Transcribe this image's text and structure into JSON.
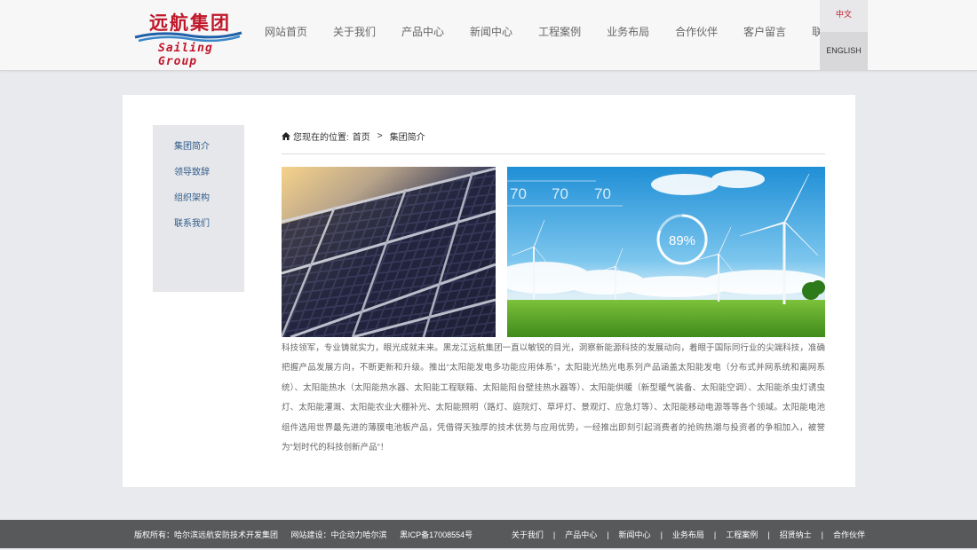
{
  "header": {
    "logo": {
      "cn": "远航集团",
      "en": "Sailing Group"
    },
    "nav": [
      "网站首页",
      "关于我们",
      "产品中心",
      "新闻中心",
      "工程案例",
      "业务布局",
      "合作伙伴",
      "客户留言",
      "联系我们"
    ],
    "lang": {
      "cn": "中文",
      "en": "ENGLISH"
    }
  },
  "sidebar": {
    "items": [
      "集团简介",
      "领导致辞",
      "组织架构",
      "联系我们"
    ]
  },
  "breadcrumb": {
    "prefix": "您现在的位置:",
    "home": "首页",
    "separator": ">",
    "current": "集团简介"
  },
  "images": {
    "wind_percent": "89%",
    "wind_numbers": [
      "70",
      "70",
      "70"
    ]
  },
  "article": "科技领军，专业铸就实力，眼光成就未来。黑龙江远航集团一直以敏锐的目光，洞察新能源科技的发展动向，着眼于国际同行业的尖端科技，准确把握产品发展方向，不断更新和升级。推出“太阳能发电多功能应用体系”，太阳能光热光电系列产品涵盖太阳能发电（分布式并网系统和离网系统）、太阳能热水（太阳能热水器、太阳能工程联箱、太阳能阳台壁挂热水器等）、太阳能供暖（新型暖气装备、太阳能空调）、太阳能杀虫灯诱虫灯、太阳能灌溉、太阳能农业大棚补光、太阳能照明（路灯、庭院灯、草坪灯、景观灯、应急灯等）、太阳能移动电源等等各个领域。太阳能电池组件选用世界最先进的薄膜电池板产品，凭借得天独厚的技术优势与应用优势，一经推出即刻引起消费者的抢购热潮与投资者的争相加入，被誉为“划时代的科技创新产品”！",
  "footer": {
    "copyright": "版权所有：哈尔滨远航安防技术开发集团",
    "builder": "网站建设：中企动力哈尔滨",
    "icp": "黑ICP备17008554号",
    "links": [
      "关于我们",
      "产品中心",
      "新闻中心",
      "业务布局",
      "工程案例",
      "招贤纳士",
      "合作伙伴"
    ],
    "separator": "|"
  },
  "colors": {
    "brand_red": "#c0182a",
    "link_blue": "#2f5b8a",
    "footer_bg": "#58595b"
  }
}
